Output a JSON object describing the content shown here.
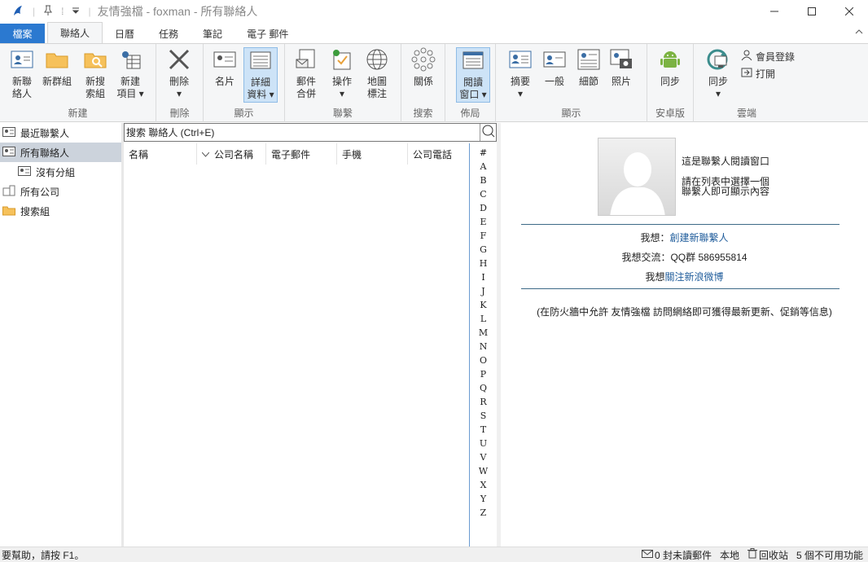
{
  "window": {
    "title": "友情強檔 - foxman - 所有聯絡人",
    "controls": [
      "minimize",
      "maximize",
      "close"
    ]
  },
  "tabs": [
    {
      "label": "檔案"
    },
    {
      "label": "聯絡人"
    },
    {
      "label": "日曆"
    },
    {
      "label": "任務"
    },
    {
      "label": "筆記"
    },
    {
      "label": "電子 郵件"
    }
  ],
  "ribbon": {
    "groups": {
      "new": "新建",
      "delete": "刪除",
      "view": "顯示",
      "contact": "聯繫",
      "search": "搜索",
      "layout": "佈局",
      "view2": "顯示",
      "android": "安卓版",
      "cloud": "雲端"
    },
    "buttons": {
      "new_contact": "新聯\n絡人",
      "new_group": "新群組",
      "new_search_group": "新搜\n索組",
      "new_item": "新建\n項目",
      "delete": "刪除",
      "card": "名片",
      "detail": "詳細\n資料",
      "mail_merge": "郵件\n合併",
      "action": "操作",
      "map": "地圖\n標注",
      "relation": "關係",
      "reading_window": "閱讀\n窗口",
      "summary": "摘要",
      "general": "一般",
      "detail2": "細節",
      "photo": "照片",
      "sync_android": "同步",
      "sync_cloud": "同步",
      "member_login": "會員登錄",
      "open": "打開"
    }
  },
  "nav": {
    "items": [
      {
        "label": "最近聯繫人"
      },
      {
        "label": "所有聯絡人"
      },
      {
        "label": "沒有分組"
      },
      {
        "label": "所有公司"
      },
      {
        "label": "搜索組"
      }
    ]
  },
  "search": {
    "placeholder": "搜索 聯絡人 (Ctrl+E)"
  },
  "columns": [
    "名稱",
    "公司名稱",
    "電子郵件",
    "手機",
    "公司電話"
  ],
  "alphabet": [
    "#",
    "A",
    "B",
    "C",
    "D",
    "E",
    "F",
    "G",
    "H",
    "I",
    "J",
    "K",
    "L",
    "M",
    "N",
    "O",
    "P",
    "Q",
    "R",
    "S",
    "T",
    "U",
    "V",
    "W",
    "X",
    "Y",
    "Z"
  ],
  "reading": {
    "heading": "這是聯繫人閱讀窗口",
    "hint1": "請在列表中選擇一個",
    "hint2": "聯繫人即可顯示內容",
    "want_prefix": "我想：",
    "want_link": "創建新聯繫人",
    "qq_line": "我想交流：QQ群 586955814",
    "weibo_prefix": "我想",
    "weibo_link": "關注新浪微博",
    "firewall_note": "(在防火牆中允許 友情強檔 訪問網絡即可獲得最新更新、促銷等信息)"
  },
  "status": {
    "help": "要幫助，請按 F1。",
    "unread": "0 封未讀郵件",
    "local": "本地",
    "recycle": "回收站",
    "unavailable": "5 個不可用功能"
  },
  "colors": {
    "accent": "#2b79d0",
    "link": "#1f5c9b",
    "selected_nav": "#ccd3dc"
  }
}
